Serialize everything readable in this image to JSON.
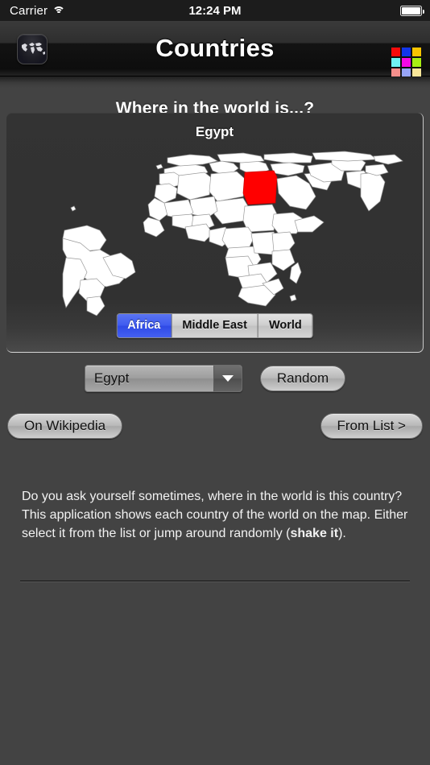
{
  "status_bar": {
    "carrier": "Carrier",
    "wifi_icon": "wifi-icon",
    "time": "12:24 PM",
    "battery_icon": "battery-full-icon"
  },
  "nav_bar": {
    "title": "Countries",
    "app_icon": "world-map-app-icon",
    "grid_button_icon": "color-grid-icon",
    "grid_colors": [
      "#f50b0b",
      "#1236ea",
      "#f8c400",
      "#6ff2f2",
      "#f508e8",
      "#a8ee12",
      "#f58f8c",
      "#97a4f7",
      "#f9e79a"
    ]
  },
  "main": {
    "headline": "Where in the world is...?",
    "map_panel": {
      "country_title": "Egypt",
      "highlight_color": "#ff0000",
      "land_color": "#ffffff",
      "ocean_color": "#2f2f2f",
      "segments": [
        {
          "label": "Africa",
          "selected": true
        },
        {
          "label": "Middle East",
          "selected": false
        },
        {
          "label": "World",
          "selected": false
        }
      ]
    },
    "country_select": {
      "value": "Egypt",
      "chevron_icon": "chevron-down-icon"
    },
    "random_button": "Random",
    "wikipedia_button": "On Wikipedia",
    "from_list_button": "From List >",
    "description_part1": "Do you ask yourself sometimes, where in the world is this country? This application shows each country of the world on the map. Either select it from the list or jump around randomly (",
    "description_bold": "shake it",
    "description_part2": ")."
  }
}
